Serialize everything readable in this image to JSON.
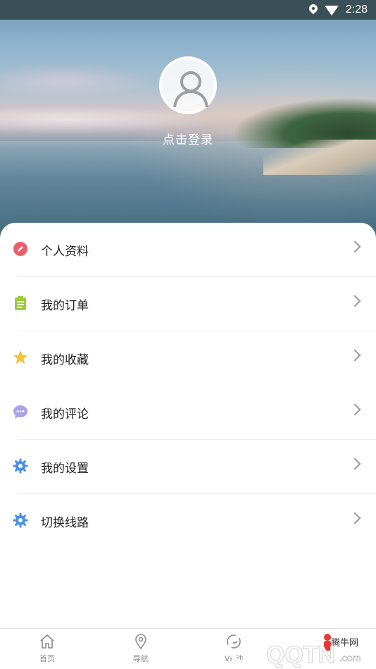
{
  "status_bar": {
    "time": "2:28",
    "icons": [
      "location-icon",
      "wifi-icon"
    ]
  },
  "profile": {
    "login_text": "点击登录",
    "avatar_icon": "user-avatar-icon"
  },
  "menu": [
    {
      "label": "个人资料",
      "icon": "pencil-icon",
      "color": "#ef5d6a"
    },
    {
      "label": "我的订单",
      "icon": "clipboard-icon",
      "color": "#9ccc3a"
    },
    {
      "label": "我的收藏",
      "icon": "star-icon",
      "color": "#f5c534"
    },
    {
      "label": "我的评论",
      "icon": "chat-icon",
      "color": "#a9a3e8"
    },
    {
      "label": "我的设置",
      "icon": "gear-icon",
      "color": "#4a90e2"
    },
    {
      "label": "切换线路",
      "icon": "gear-icon",
      "color": "#4a90e2"
    }
  ],
  "bottom_nav": [
    {
      "label": "首页",
      "icon": "home-icon"
    },
    {
      "label": "导航",
      "icon": "map-pin-icon"
    },
    {
      "label": "VR动",
      "icon": "vr-icon"
    }
  ],
  "watermark": {
    "brand": "腾牛网",
    "site": "QQTN",
    "tld": ".com"
  }
}
